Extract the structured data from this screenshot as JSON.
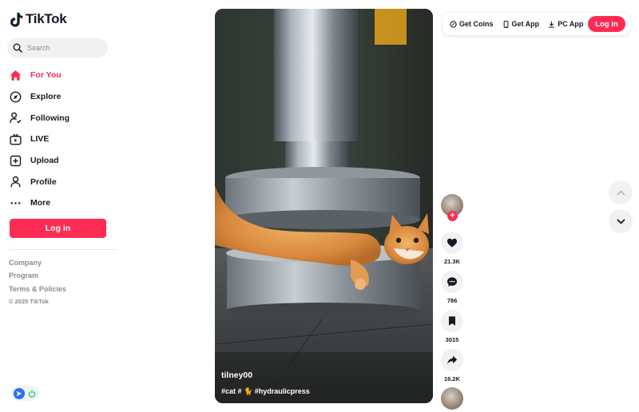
{
  "app": {
    "logo_text": "TikTok"
  },
  "search": {
    "placeholder": "Search"
  },
  "nav": {
    "items": [
      {
        "label": "For You",
        "icon": "home-icon",
        "active": true
      },
      {
        "label": "Explore",
        "icon": "compass-icon",
        "active": false
      },
      {
        "label": "Following",
        "icon": "following-icon",
        "active": false
      },
      {
        "label": "LIVE",
        "icon": "live-icon",
        "active": false
      },
      {
        "label": "Upload",
        "icon": "upload-icon",
        "active": false
      },
      {
        "label": "Profile",
        "icon": "profile-icon",
        "active": false
      },
      {
        "label": "More",
        "icon": "more-icon",
        "active": false
      }
    ]
  },
  "sidebar": {
    "login_label": "Log in",
    "footer_links": [
      "Company",
      "Program",
      "Terms & Policies"
    ],
    "copyright": "© 2025 TikTok"
  },
  "video": {
    "author": "tilney00",
    "tags": "#cat # 🐈 #hydraulicpress"
  },
  "actions": {
    "likes": "21.3K",
    "comments": "786",
    "saves": "3015",
    "shares": "16.2K"
  },
  "topbar": {
    "get_coins": "Get Coins",
    "get_app": "Get App",
    "pc_app": "PC App",
    "login_label": "Log in"
  },
  "colors": {
    "brand_red": "#fe2c55",
    "logo_cyan": "#25f4ee",
    "text": "#161823",
    "muted": "#8a8b91"
  }
}
